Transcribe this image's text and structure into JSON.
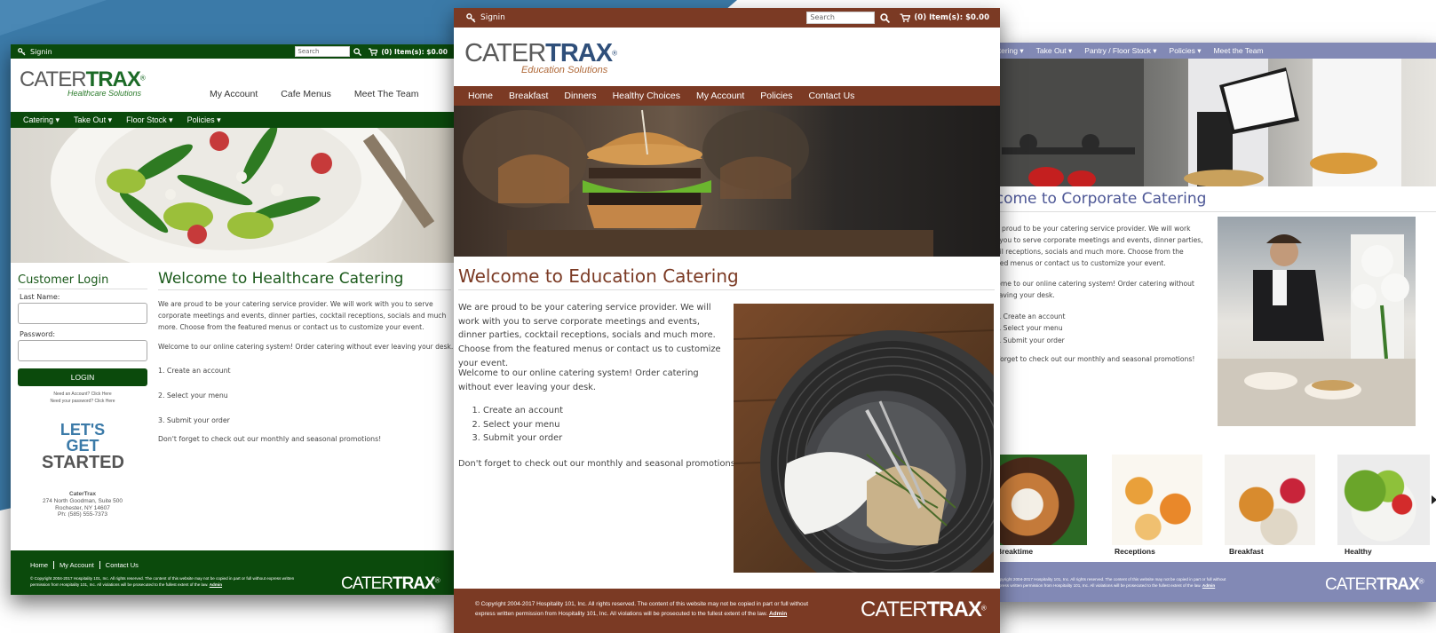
{
  "colors": {
    "blue": "#3b7aa8",
    "green": "#0b4a0c",
    "brown": "#7b3a24",
    "lavender": "#8289b5"
  },
  "healthcare": {
    "signin": "Signin",
    "search_placeholder": "Search",
    "cart": "(0) Item(s): $0.00",
    "logo_a": "CATER",
    "logo_b": "TRAX",
    "logo_sub": "Healthcare Solutions",
    "header_links": [
      "My Account",
      "Cafe Menus",
      "Meet The Team"
    ],
    "nav": [
      "Catering ▾",
      "Take Out ▾",
      "Floor Stock ▾",
      "Policies ▾"
    ],
    "login_title": "Customer Login",
    "last_name_label": "Last Name:",
    "password_label": "Password:",
    "login_button": "LOGIN",
    "need_account": "Need an Account? Click Here",
    "forgot": "Need your password? Click Here",
    "promo_line1": "LET'S GET",
    "promo_line2": "STARTED",
    "address": [
      "CaterTrax",
      "274 North Goodman, Suite 500",
      "Rochester, NY 14607",
      "Ph: (585) 555-7373"
    ],
    "welcome_title": "Welcome to Healthcare Catering",
    "intro": "We are proud to be your catering service provider. We will work with you to serve corporate meetings and events, dinner parties, cocktail receptions, socials and much more. Choose from the featured menus or contact us to customize your event.",
    "online": "Welcome to our online catering system! Order catering without ever leaving your desk.",
    "steps": [
      "1. Create an account",
      "2. Select your menu",
      "3. Submit your order"
    ],
    "promo": "Don't forget to check out our monthly and seasonal promotions!",
    "footer_links": [
      "Home",
      "My Account",
      "Contact Us"
    ],
    "copyright": "© Copyright 2004-2017 Hospitality 101, Inc. All rights reserved. The content of this website may not be copied in part or full without express written permission from Hospitality 101, Inc. All violations will be prosecuted to the fullest extent of the law.",
    "admin": "Admin",
    "footer_logo_a": "CATER",
    "footer_logo_b": "TRAX"
  },
  "education": {
    "signin": "Signin",
    "search_placeholder": "Search",
    "cart": "(0) Item(s): $0.00",
    "logo_a": "CATER",
    "logo_b": "TRAX",
    "logo_sub": "Education Solutions",
    "nav": [
      "Home",
      "Breakfast",
      "Dinners",
      "Healthy Choices",
      "My Account",
      "Policies",
      "Contact Us"
    ],
    "welcome_title": "Welcome to Education Catering",
    "intro": "We are proud to be your catering service provider. We will work with you to serve corporate meetings and events, dinner parties, cocktail receptions, socials and much more. Choose from the featured menus or contact us to customize your event.",
    "online": "Welcome to our online catering system! Order catering without ever leaving your desk.",
    "steps": [
      "Create an account",
      "Select your menu",
      "Submit your order"
    ],
    "promo": "Don't forget to check out our monthly and seasonal promotions!",
    "copyright": "© Copyright 2004-2017 Hospitality 101, Inc. All rights reserved. The content of this website may not be copied in part or full without express written permission from Hospitality 101, Inc. All violations will be prosecuted to the fullest extent of the law.",
    "admin": "Admin",
    "footer_logo_a": "CATER",
    "footer_logo_b": "TRAX"
  },
  "corporate": {
    "nav": [
      "atering ▾",
      "Take Out ▾",
      "Pantry / Floor Stock ▾",
      "Policies ▾",
      "Meet the Team"
    ],
    "welcome_title": "lcome to Corporate Catering",
    "intro_lines": [
      "re proud to be your catering service provider. We will work",
      "h you to serve corporate meetings and events, dinner parties,",
      "tail receptions, socials and much more. Choose from the",
      "ured menus or contact us to customize your event."
    ],
    "online_lines": [
      "come to our online catering system! Order catering without",
      "leaving your desk."
    ],
    "steps": [
      "1. Create an account",
      "2. Select your menu",
      "3. Submit your order"
    ],
    "promo": "t forget to check out our monthly and seasonal promotions!",
    "tiles": [
      "Breaktime",
      "Receptions",
      "Breakfast",
      "Healthy"
    ],
    "copyright_lines": [
      "Copyright 2004-2017 Hospitality 101, Inc. All rights reserved. The content of this website may not be copied in part or full without",
      "express written permission from Hospitality 101, Inc. All violations will be prosecuted to the fullest extent of the law."
    ],
    "admin": "Admin",
    "footer_logo_a": "CATER",
    "footer_logo_b": "TRAX"
  }
}
